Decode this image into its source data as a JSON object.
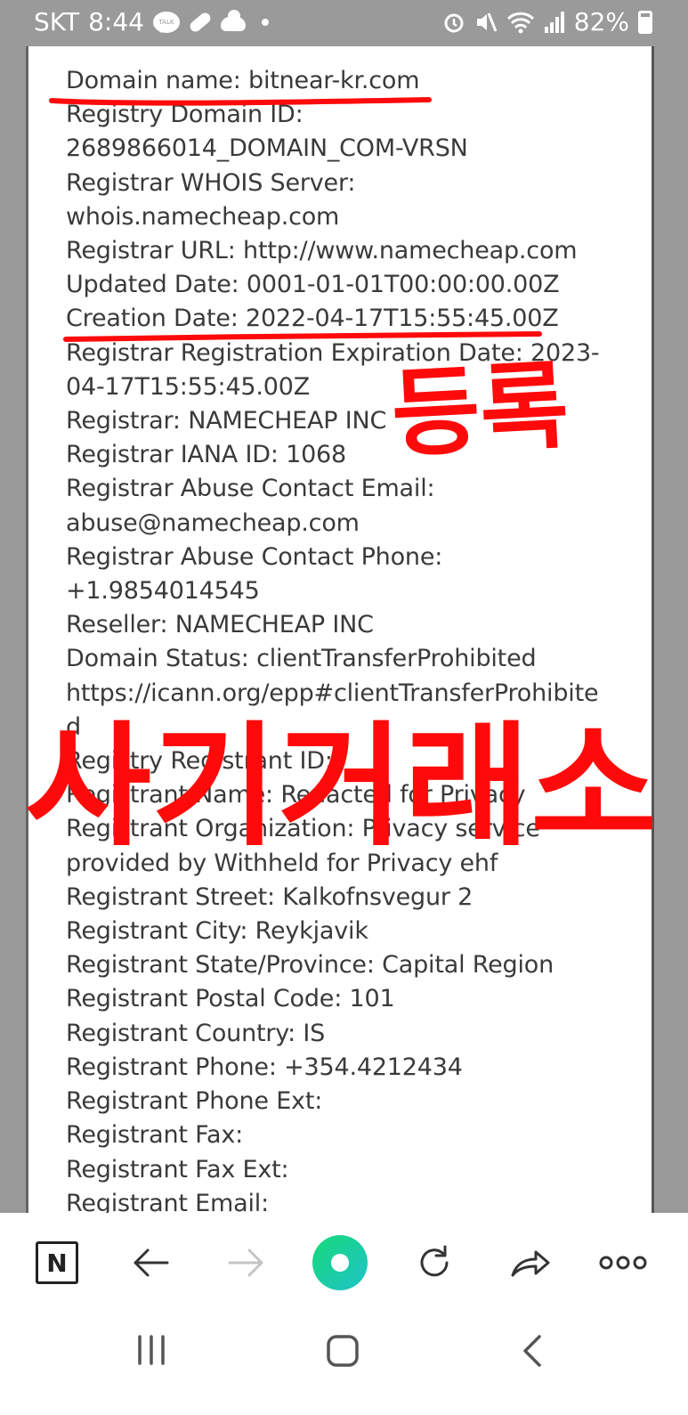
{
  "status_bar": {
    "carrier": "SKT",
    "time": "8:44",
    "talk_label": "TALK",
    "battery": "82%"
  },
  "whois": {
    "lines": [
      "Domain name: bitnear-kr.com",
      "Registry Domain ID:",
      "2689866014_DOMAIN_COM-VRSN",
      "Registrar WHOIS Server:",
      "whois.namecheap.com",
      "Registrar URL: http://www.namecheap.com",
      "Updated Date: 0001-01-01T00:00:00.00Z",
      "Creation Date: 2022-04-17T15:55:45.00Z",
      "Registrar Registration Expiration Date: 2023-",
      "04-17T15:55:45.00Z",
      "Registrar: NAMECHEAP INC",
      "Registrar IANA ID: 1068",
      "Registrar Abuse Contact Email:",
      "abuse@namecheap.com",
      "Registrar Abuse Contact Phone:",
      "+1.9854014545",
      "Reseller: NAMECHEAP INC",
      "Domain Status: clientTransferProhibited",
      "https://icann.org/epp#clientTransferProhibite",
      "d",
      "Registry Registrant ID:",
      "Registrant Name: Redacted for Privacy",
      "Registrant Organization: Privacy service",
      "provided by Withheld for Privacy ehf",
      "Registrant Street: Kalkofnsvegur 2",
      "Registrant City: Reykjavik",
      "Registrant State/Province: Capital Region",
      "Registrant Postal Code: 101",
      "Registrant Country: IS",
      "Registrant Phone: +354.4212434",
      "Registrant Phone Ext:",
      "Registrant Fax:",
      "Registrant Fax Ext:",
      "Registrant Email:"
    ]
  },
  "annotations": {
    "registration_label": "등록",
    "scam_label": "사기거래소",
    "ink_color": "#ff0a0a"
  },
  "toolbar": {
    "logo_letter": "N",
    "back_icon": "arrow-left-icon",
    "forward_icon": "arrow-right-icon",
    "home_icon": "green-circle-icon",
    "refresh_icon": "refresh-icon",
    "share_icon": "share-icon",
    "more_icon": "more-icon"
  }
}
